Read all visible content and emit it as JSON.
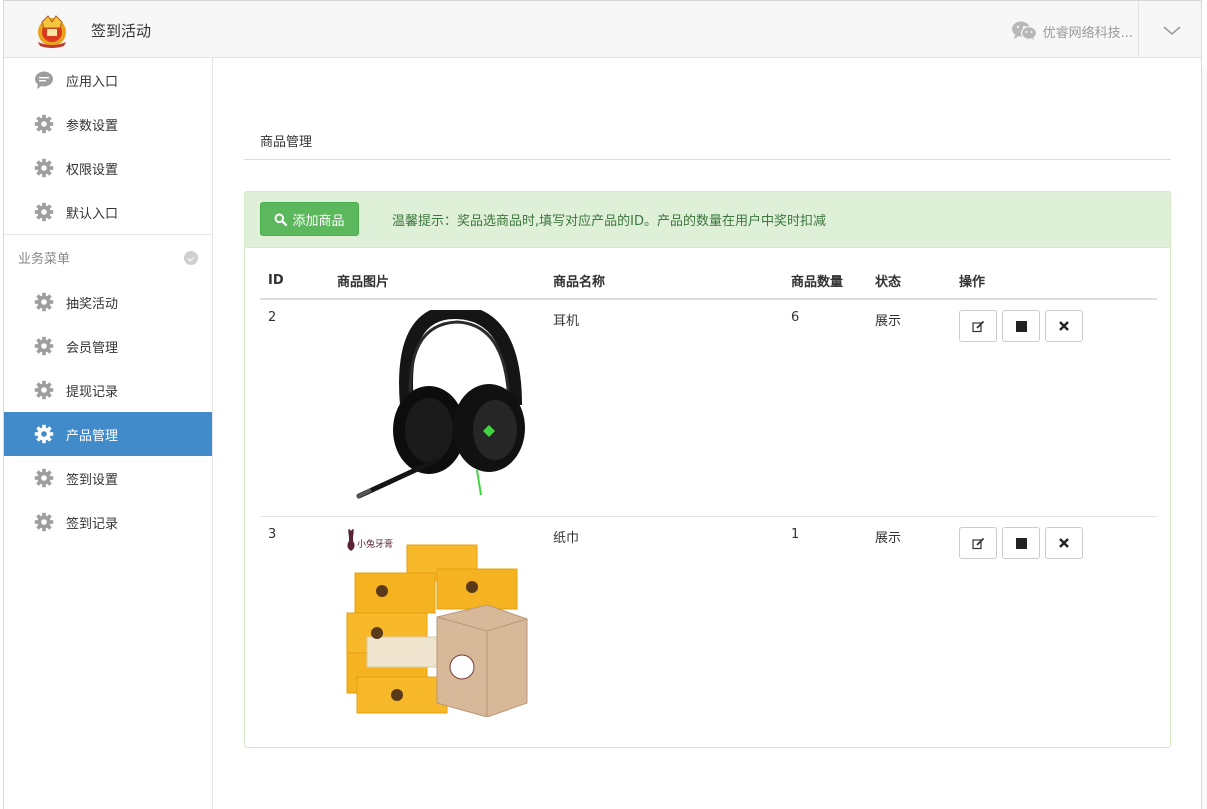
{
  "header": {
    "title": "签到活动",
    "company": "优睿网络科技..."
  },
  "sidebar": {
    "top_items": [
      {
        "label": "应用入口",
        "icon": "chat-bubble-icon"
      },
      {
        "label": "参数设置",
        "icon": "gear-icon"
      },
      {
        "label": "权限设置",
        "icon": "gear-icon"
      },
      {
        "label": "默认入口",
        "icon": "gear-icon"
      }
    ],
    "section_title": "业务菜单",
    "items": [
      {
        "label": "抽奖活动",
        "icon": "gear-icon",
        "active": false
      },
      {
        "label": "会员管理",
        "icon": "gear-icon",
        "active": false
      },
      {
        "label": "提现记录",
        "icon": "gear-icon",
        "active": false
      },
      {
        "label": "产品管理",
        "icon": "gear-icon",
        "active": true
      },
      {
        "label": "签到设置",
        "icon": "gear-icon",
        "active": false
      },
      {
        "label": "签到记录",
        "icon": "gear-icon",
        "active": false
      }
    ]
  },
  "main": {
    "heading": "商品管理",
    "add_button": "添加商品",
    "tip": "温馨提示：奖品选商品时,填写对应产品的ID。产品的数量在用户中奖时扣减",
    "columns": [
      "ID",
      "商品图片",
      "商品名称",
      "商品数量",
      "状态",
      "操作"
    ],
    "rows": [
      {
        "id": "2",
        "name": "耳机",
        "qty": "6",
        "status": "展示",
        "image": "headset-image"
      },
      {
        "id": "3",
        "name": "纸巾",
        "qty": "1",
        "status": "展示",
        "image": "tissue-image",
        "brand": "小兔牙膏"
      }
    ]
  },
  "colors": {
    "active_nav": "#428bca",
    "success_green": "#5cb85c",
    "panel_bg": "#dff0d8",
    "tip_text": "#3c763d"
  }
}
